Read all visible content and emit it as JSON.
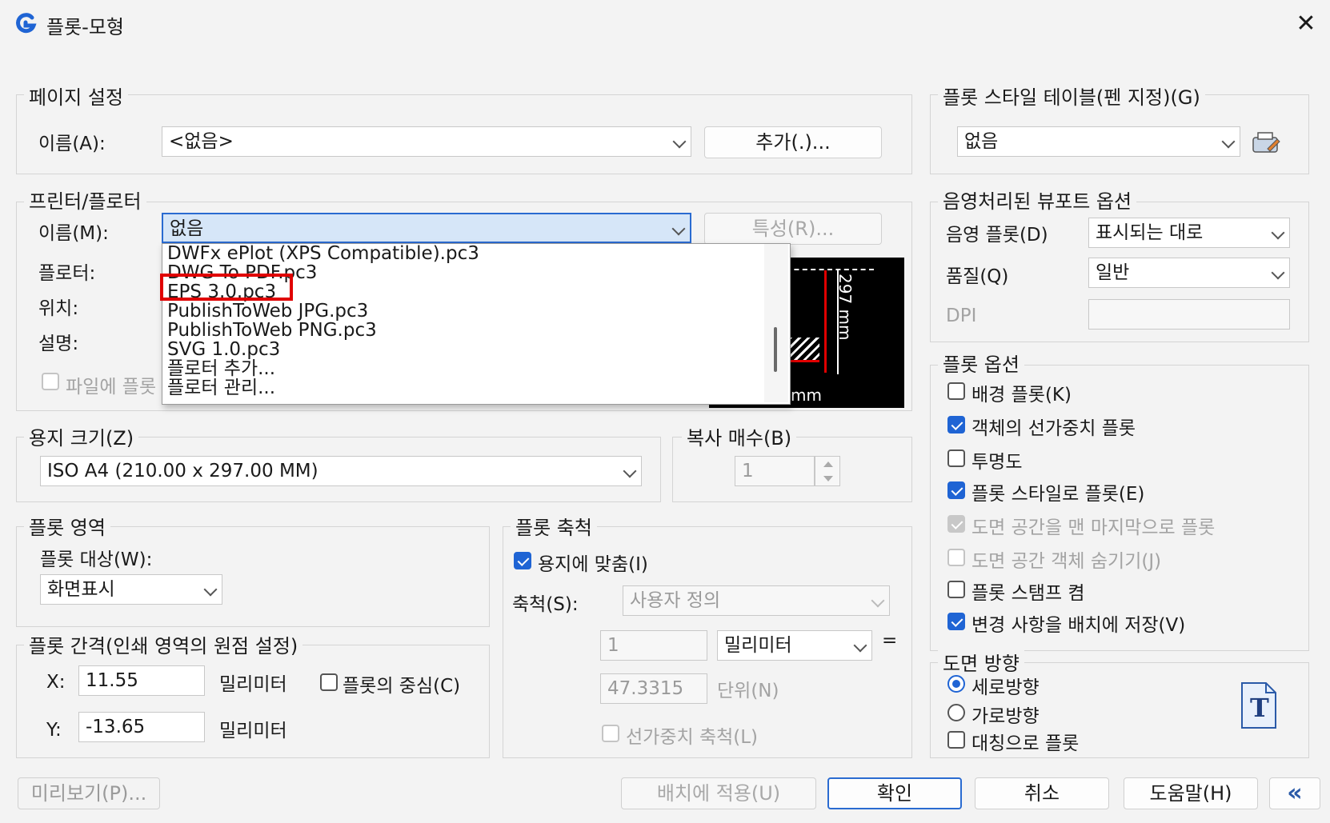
{
  "window": {
    "title": "플롯-모형",
    "close_glyph": "✕"
  },
  "page_setup": {
    "legend": "페이지 설정",
    "name_label": "이름(A):",
    "name_value": "<없음>",
    "add_button": "추가(.)..."
  },
  "printer": {
    "legend": "프린터/플로터",
    "name_label": "이름(M):",
    "name_value": "없음",
    "properties_button": "특성(R)...",
    "plotter_label": "플로터:",
    "location_label": "위치:",
    "description_label": "설명:",
    "plot_to_file_label": "파일에 플롯",
    "dropdown_items": [
      "DWFx ePlot (XPS Compatible).pc3",
      "DWG To PDF.pc3",
      "EPS 3.0.pc3",
      "PublishToWeb JPG.pc3",
      "PublishToWeb PNG.pc3",
      "SVG 1.0.pc3",
      "플로터 추가...",
      "플로터 관리..."
    ],
    "highlighted_item": "EPS 3.0.pc3",
    "preview_height_label": "297 mm",
    "preview_width_label": "mm"
  },
  "paper_size": {
    "legend": "용지 크기(Z)",
    "value": "ISO A4 (210.00 x 297.00 MM)"
  },
  "copies": {
    "legend": "복사 매수(B)",
    "value": "1"
  },
  "plot_area": {
    "legend": "플롯 영역",
    "what_label": "플롯 대상(W):",
    "what_value": "화면표시"
  },
  "plot_offset": {
    "legend": "플롯 간격(인쇄 영역의 원점 설정)",
    "x_label": "X:",
    "x_value": "11.55",
    "y_label": "Y:",
    "y_value": "-13.65",
    "unit": "밀리미터",
    "center_label": "플롯의 중심(C)"
  },
  "plot_scale": {
    "legend": "플롯 축척",
    "fit_label": "용지에 맞춤(I)",
    "scale_label": "축척(S):",
    "scale_value": "사용자 정의",
    "value1": "1",
    "unit_value": "밀리미터",
    "equals": "=",
    "value2": "47.3315",
    "units_label": "단위(N)",
    "lineweight_label": "선가중치 축척(L)"
  },
  "plot_style_table": {
    "legend": "플롯 스타일 테이블(펜 지정)(G)",
    "value": "없음"
  },
  "shaded_viewport": {
    "legend": "음영처리된 뷰포트 옵션",
    "shade_label": "음영 플롯(D)",
    "shade_value": "표시되는 대로",
    "quality_label": "품질(Q)",
    "quality_value": "일반",
    "dpi_label": "DPI"
  },
  "plot_options": {
    "legend": "플롯 옵션",
    "items": [
      {
        "label": "배경 플롯(K)",
        "state": "off"
      },
      {
        "label": "객체의 선가중치 플롯",
        "state": "on"
      },
      {
        "label": "투명도",
        "state": "off"
      },
      {
        "label": "플롯 스타일로 플롯(E)",
        "state": "on"
      },
      {
        "label": "도면 공간을 맨 마지막으로 플롯",
        "state": "disabled-on"
      },
      {
        "label": "도면 공간 객체 숨기기(J)",
        "state": "disabled-off"
      },
      {
        "label": "플롯 스탬프 켬",
        "state": "off"
      },
      {
        "label": "변경 사항을 배치에 저장(V)",
        "state": "on"
      }
    ]
  },
  "orientation": {
    "legend": "도면 방향",
    "portrait": "세로방향",
    "landscape": "가로방향",
    "upside_down": "대칭으로 플롯",
    "icon_letter": "T"
  },
  "footer": {
    "preview": "미리보기(P)...",
    "apply": "배치에 적용(U)",
    "ok": "확인",
    "cancel": "취소",
    "help": "도움말(H)",
    "collapse": "«"
  },
  "colors": {
    "accent": "#1f64d4",
    "highlight_box": "#e00000"
  }
}
